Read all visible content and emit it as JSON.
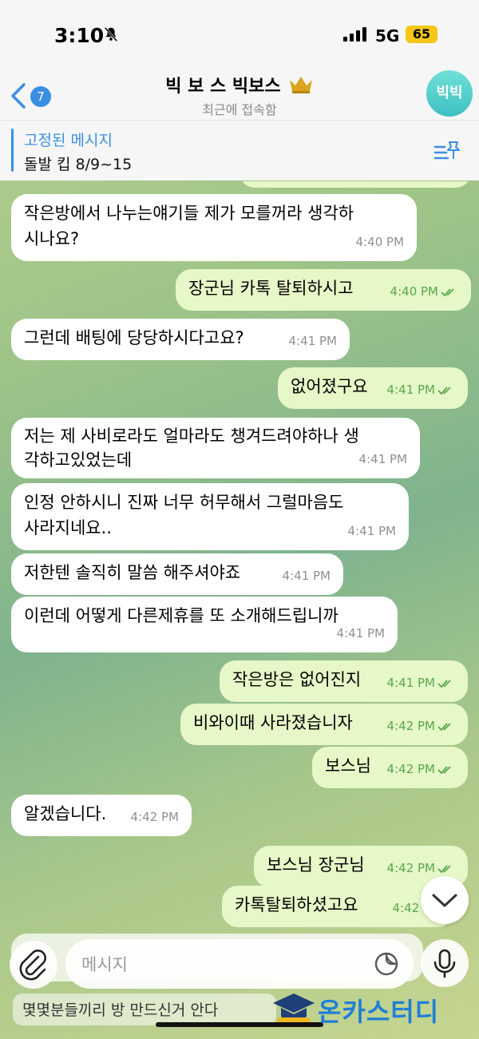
{
  "status_bar": {
    "time": "3:10",
    "network": "5G",
    "battery": "65"
  },
  "header": {
    "back_count": "7",
    "title": "빅 보 스 빅보스",
    "subtitle": "최근에 접속함",
    "avatar_text": "빅빅"
  },
  "pinned": {
    "title": "고정된 메시지",
    "text": "돌발 킵 8/9~15"
  },
  "messages": [
    {
      "dir": "in",
      "text": "작은방에서 나누는얘기들 제가 모를꺼라 생각하\n시나요?",
      "time": "4:40 PM"
    },
    {
      "dir": "out",
      "text": "장군님 카톡 탈퇴하시고",
      "time": "4:40 PM"
    },
    {
      "dir": "in",
      "text": "그런데 배팅에 당당하시다고요?",
      "time": "4:41 PM"
    },
    {
      "dir": "out",
      "text": "없어졌구요",
      "time": "4:41 PM"
    },
    {
      "dir": "in",
      "text": "저는 제 사비로라도 얼마라도 챙겨드려야하나 생\n각하고있었는데",
      "time": "4:41 PM"
    },
    {
      "dir": "in",
      "text": "인정 안하시니 진짜 너무 허무해서 그럴마음도\n사라지네요..",
      "time": "4:41 PM"
    },
    {
      "dir": "in",
      "text": "저한텐 솔직히 말씀 해주셔야죠",
      "time": "4:41 PM"
    },
    {
      "dir": "in",
      "text": "이런데 어떻게 다른제휴를 또 소개해드립니까",
      "time": "4:41 PM"
    },
    {
      "dir": "out",
      "text": "작은방은 없어진지",
      "time": "4:41 PM"
    },
    {
      "dir": "out",
      "text": "비와이때 사라졌습니자",
      "time": "4:42 PM"
    },
    {
      "dir": "out",
      "text": "보스님",
      "time": "4:42 PM"
    },
    {
      "dir": "in",
      "text": "알겠습니다.",
      "time": "4:42 PM"
    },
    {
      "dir": "out",
      "text": "보스님 장군님",
      "time": "4:42 PM"
    },
    {
      "dir": "out",
      "text": "카톡탈퇴하셨고요",
      "time": "4:42 PM"
    }
  ],
  "composer": {
    "placeholder": "메시지",
    "preview": "몇몇분들끼리 방 만드신거 안다"
  },
  "watermark": "온카스터디",
  "colors": {
    "accent": "#3b8fe2",
    "outgoing_bubble": "#e6f7c8",
    "incoming_bubble": "#ffffff",
    "read_check": "#57a84a"
  }
}
